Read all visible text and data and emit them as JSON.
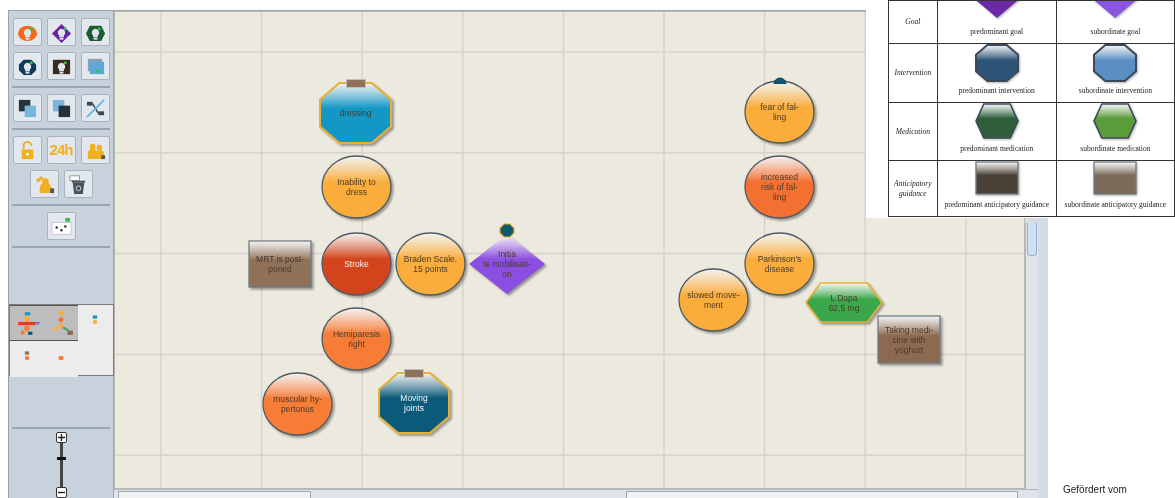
{
  "toolbar": {
    "clock_label": "24h"
  },
  "overview": {
    "thumbnails": [
      {
        "selected": true
      },
      {
        "selected": true
      },
      {
        "selected": false
      },
      {
        "selected": false
      },
      {
        "selected": false
      }
    ]
  },
  "zoom": {
    "level": 0.66
  },
  "canvas": {
    "nodes": [
      {
        "kind": "octagon",
        "color": "#1496c6",
        "lines": [
          "dressing"
        ],
        "badge": {
          "kind": "tab"
        }
      },
      {
        "kind": "circle",
        "color": "#fbad3c",
        "lines": [
          "Inability to",
          "dress"
        ]
      },
      {
        "kind": "rect",
        "color": "#8f7058",
        "lines": [
          "MRT is post-",
          "poned"
        ]
      },
      {
        "kind": "circle",
        "color": "#d4441c",
        "lines": [
          "Stroke"
        ]
      },
      {
        "kind": "circle",
        "color": "#fbad3c",
        "lines": [
          "Braden Scale.",
          "15 points"
        ]
      },
      {
        "kind": "diamond",
        "color": "#8a4fe0",
        "lines": [
          "Initia",
          "te mobilisati-",
          "on"
        ],
        "badge": {
          "kind": "octagon"
        }
      },
      {
        "kind": "circle",
        "color": "#f77c36",
        "lines": [
          "Hemiparesis",
          "right"
        ]
      },
      {
        "kind": "circle",
        "color": "#f77c36",
        "lines": [
          "muscular hy-",
          "pertonus"
        ]
      },
      {
        "kind": "octagon",
        "color": "#0b5a7a",
        "lines": [
          "Moving",
          "joints"
        ],
        "badge": {
          "kind": "tab"
        }
      },
      {
        "kind": "circle",
        "color": "#fbad3c",
        "lines": [
          "fear of fal-",
          "ling"
        ],
        "badge": {
          "kind": "dot"
        }
      },
      {
        "kind": "circle",
        "color": "#f47030",
        "lines": [
          "increased",
          "risk of fal-",
          "ling"
        ]
      },
      {
        "kind": "circle",
        "color": "#fbad3c",
        "lines": [
          "Parkinson's",
          "disease"
        ]
      },
      {
        "kind": "circle",
        "color": "#fbad3c",
        "lines": [
          "slowed move-",
          "ment"
        ]
      },
      {
        "kind": "hexagon",
        "color": "#3aa84a",
        "lines": [
          "L Dopa",
          "62,5 mg"
        ]
      },
      {
        "kind": "rect",
        "color": "#8c6a52",
        "lines": [
          "Taking medi-",
          "cine with",
          "yoghurt"
        ]
      }
    ]
  },
  "legend": {
    "rows": [
      {
        "category": "Goal",
        "kind": "goal",
        "cells": [
          {
            "color": "#6a2aa8",
            "caption": "predominant goal"
          },
          {
            "color": "#8a55e0",
            "caption": "subordinate goal"
          }
        ]
      },
      {
        "category": "Intervention",
        "kind": "intervention",
        "cells": [
          {
            "color": "#2e5478",
            "caption": "predominant intervention"
          },
          {
            "color": "#5b8fc4",
            "caption": "subordinate intervention"
          }
        ]
      },
      {
        "category": "Medication",
        "kind": "medication",
        "cells": [
          {
            "color": "#2f5f3a",
            "caption": "predominant medication"
          },
          {
            "color": "#5a9c3a",
            "caption": "subordinate medication"
          }
        ]
      },
      {
        "category": "Anticipatory guidance",
        "kind": "guidance",
        "cells": [
          {
            "color": "#4a4036",
            "caption": "predominant anticipatory guidance"
          },
          {
            "color": "#7d6a58",
            "caption": "subordinate anticipatory guidance"
          }
        ]
      }
    ]
  },
  "footer": {
    "text": "Gefördert vom"
  }
}
